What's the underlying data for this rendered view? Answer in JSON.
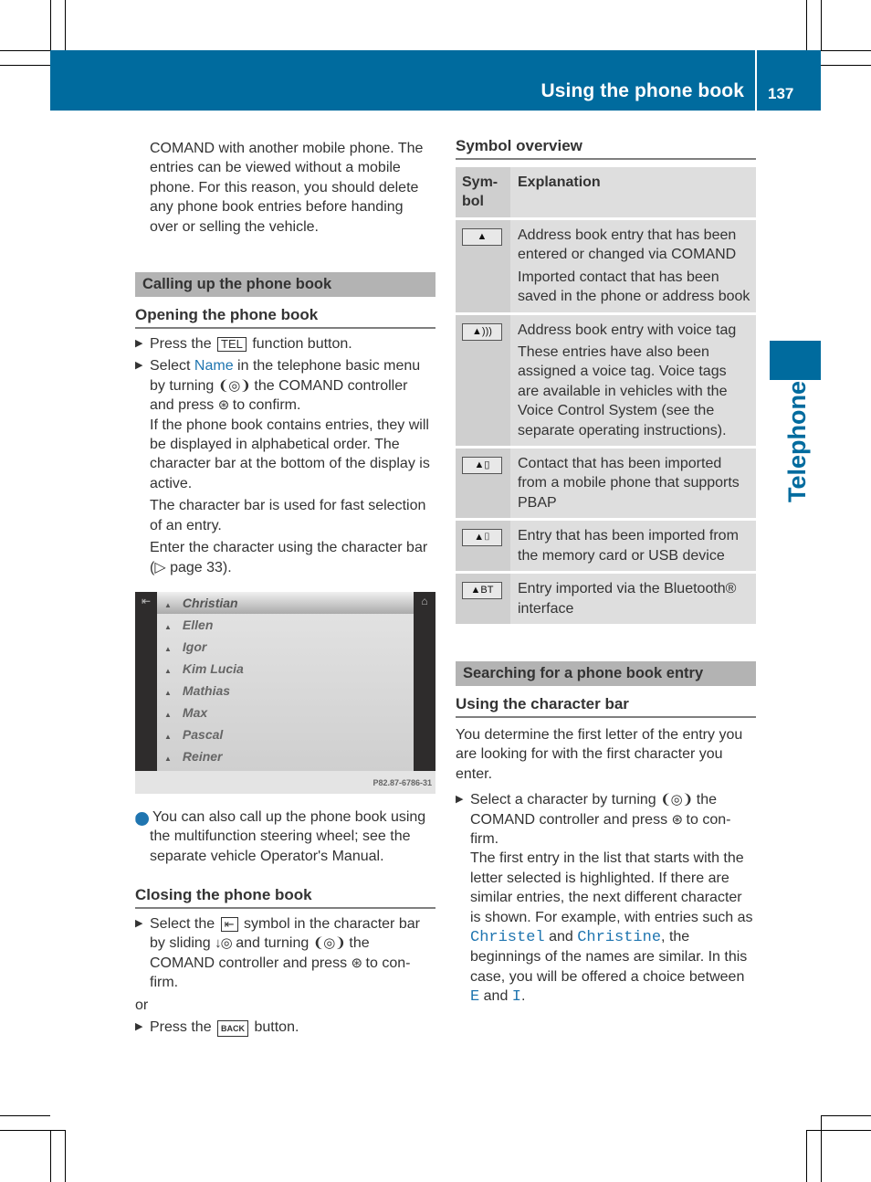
{
  "header": {
    "title": "Using the phone book",
    "page_number": "137"
  },
  "side_tab": {
    "label": "Telephone"
  },
  "left": {
    "intro": "COMAND with another mobile phone. The entries can be viewed without a mobile phone. For this reason, you should delete any phone book entries before handing over or selling the vehicle.",
    "section_title": "Calling up the phone book",
    "opening": {
      "heading": "Opening the phone book",
      "step1": {
        "pre": "Press the ",
        "key": "TEL",
        "post": " function button."
      },
      "step2": {
        "pre": "Select ",
        "menu": "Name",
        "mid": " in the telephone basic menu by turning ",
        "ctrl_turn": "❨◎❩",
        "mid2": " the COMAND controller and press ",
        "ctrl_press": "⊛",
        "post": " to confirm."
      },
      "para1": "If the phone book contains entries, they will be displayed in alphabetical order. The character bar at the bottom of the display is active.",
      "para2": "The character bar is used for fast selection of an entry.",
      "para3": "Enter the character using the character bar (▷ page 33)."
    },
    "screenshot": {
      "names": [
        "Christian",
        "Ellen",
        "Igor",
        "Kim Lucia",
        "Mathias",
        "Max",
        "Pascal",
        "Reiner"
      ],
      "selected_index": 0,
      "code": "P82.87-6786-31",
      "back_icon": "⇤",
      "phone_icon": "⌂"
    },
    "info_note": "You can also call up the phone book using the multifunction steering wheel; see the separate vehicle Operator's Manual.",
    "closing": {
      "heading": "Closing the phone book",
      "step1": {
        "pre": "Select the ",
        "symbol": "⇤",
        "mid": " symbol in the character bar by sliding ",
        "ctrl_slide": "↓◎",
        "mid2": " and turning ",
        "ctrl_turn": "❨◎❩",
        "mid3": " the COMAND controller and press ",
        "ctrl_press": "⊛",
        "post": " to con-firm."
      },
      "or": "or",
      "step2": {
        "pre": "Press the ",
        "key": "BACK",
        "post": " button."
      }
    }
  },
  "right": {
    "symbol_overview": {
      "heading": "Symbol overview",
      "col_symbol": "Sym-bol",
      "col_explanation": "Explanation",
      "rows": [
        {
          "icon": "person-icon",
          "glyph": "▲",
          "lines": [
            "Address book entry that has been entered or changed via COMAND",
            "Imported contact that has been saved in the phone or address book"
          ]
        },
        {
          "icon": "person-voice-icon",
          "glyph": "▲)))",
          "lines": [
            "Address book entry with voice tag",
            "These entries have also been assigned a voice tag. Voice tags are available in vehicles with the Voice Control System (see the separate operating instructions)."
          ]
        },
        {
          "icon": "person-phone-icon",
          "glyph": "▲▯",
          "lines": [
            "Contact that has been imported from a mobile phone that supports PBAP"
          ]
        },
        {
          "icon": "person-usb-icon",
          "glyph": "▲⌷",
          "lines": [
            "Entry that has been imported from the memory card or USB device"
          ]
        },
        {
          "icon": "person-bluetooth-icon",
          "glyph": "▲BT",
          "lines": [
            "Entry imported via the Bluetooth® interface"
          ]
        }
      ]
    },
    "section_title": "Searching for a phone book entry",
    "char_bar": {
      "heading": "Using the character bar",
      "intro": "You determine the first letter of the entry you are looking for with the first character you enter.",
      "step1": {
        "pre": "Select a character by turning ",
        "ctrl_turn": "❨◎❩",
        "mid": " the COMAND controller and press ",
        "ctrl_press": "⊛",
        "post": " to con-firm."
      },
      "para": {
        "a": "The first entry in the list that starts with the letter selected is highlighted. If there are similar entries, the next different character is shown. For example, with entries such as ",
        "name1": "Christel",
        "b": " and ",
        "name2": "Christine",
        "c": ", the beginnings of the names are similar. In this case, you will be offered a choice between ",
        "letter1": "E",
        "d": " and ",
        "letter2": "I",
        "e": "."
      }
    }
  }
}
